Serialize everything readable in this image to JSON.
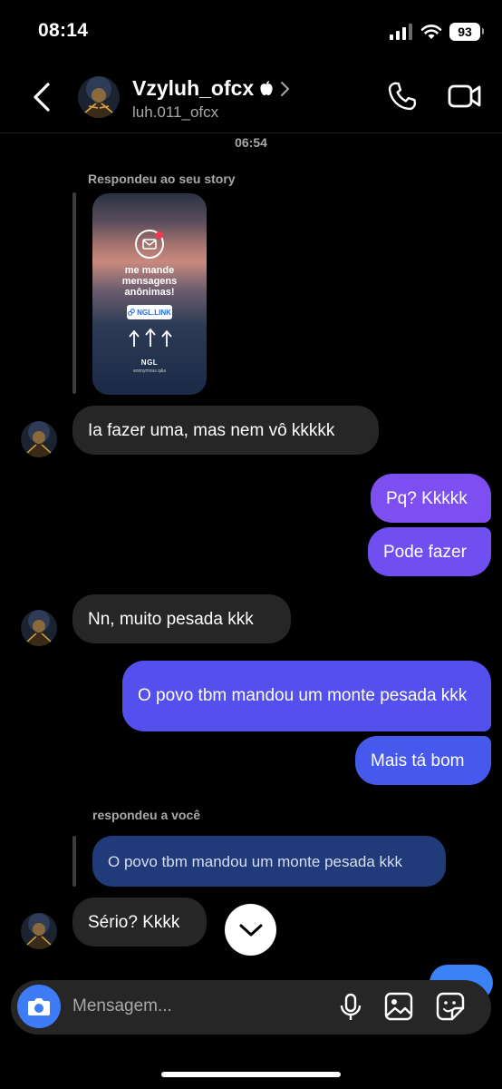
{
  "status_bar": {
    "time": "08:14",
    "battery": "93"
  },
  "header": {
    "name": "Vzyluh_ofcx",
    "username": "luh.011_ofcx"
  },
  "timestamp": "06:54",
  "story_reply": {
    "note": "Respondeu ao seu story",
    "card_title_lines": [
      "me mande",
      "mensagens",
      "anônimas!"
    ],
    "link_label": "NGL.LINK",
    "brand": "NGL",
    "small_text": "anonymous q&a"
  },
  "messages": [
    {
      "id": "m1",
      "direction": "in",
      "text": "Ia fazer uma, mas nem vô kkkkk"
    },
    {
      "id": "m2",
      "direction": "out",
      "text": "Pq? Kkkkk"
    },
    {
      "id": "m3",
      "direction": "out",
      "text": "Pode fazer"
    },
    {
      "id": "m4",
      "direction": "in",
      "text": "Nn, muito pesada kkk"
    },
    {
      "id": "m5",
      "direction": "out",
      "text": "O povo tbm mandou um monte pesada kkk"
    },
    {
      "id": "m6",
      "direction": "out",
      "text": "Mais tá bom"
    },
    {
      "id": "m7",
      "direction": "in",
      "text": "Sério? Kkkk"
    }
  ],
  "reply_quote": {
    "note": "respondeu a você",
    "quoted_text": "O povo tbm mandou um monte pesada kkk"
  },
  "composer": {
    "placeholder": "Mensagem..."
  },
  "colors": {
    "out_top": "#8a4cf0",
    "out_bottom": "#3c5ce8",
    "incoming": "#262626",
    "accent": "#3d7cf6"
  },
  "icons": [
    "back-icon",
    "verified-apple-icon",
    "chevron-right-icon",
    "phone-icon",
    "video-icon",
    "camera-icon",
    "mic-icon",
    "gallery-icon",
    "sticker-icon",
    "chevron-down-icon"
  ]
}
